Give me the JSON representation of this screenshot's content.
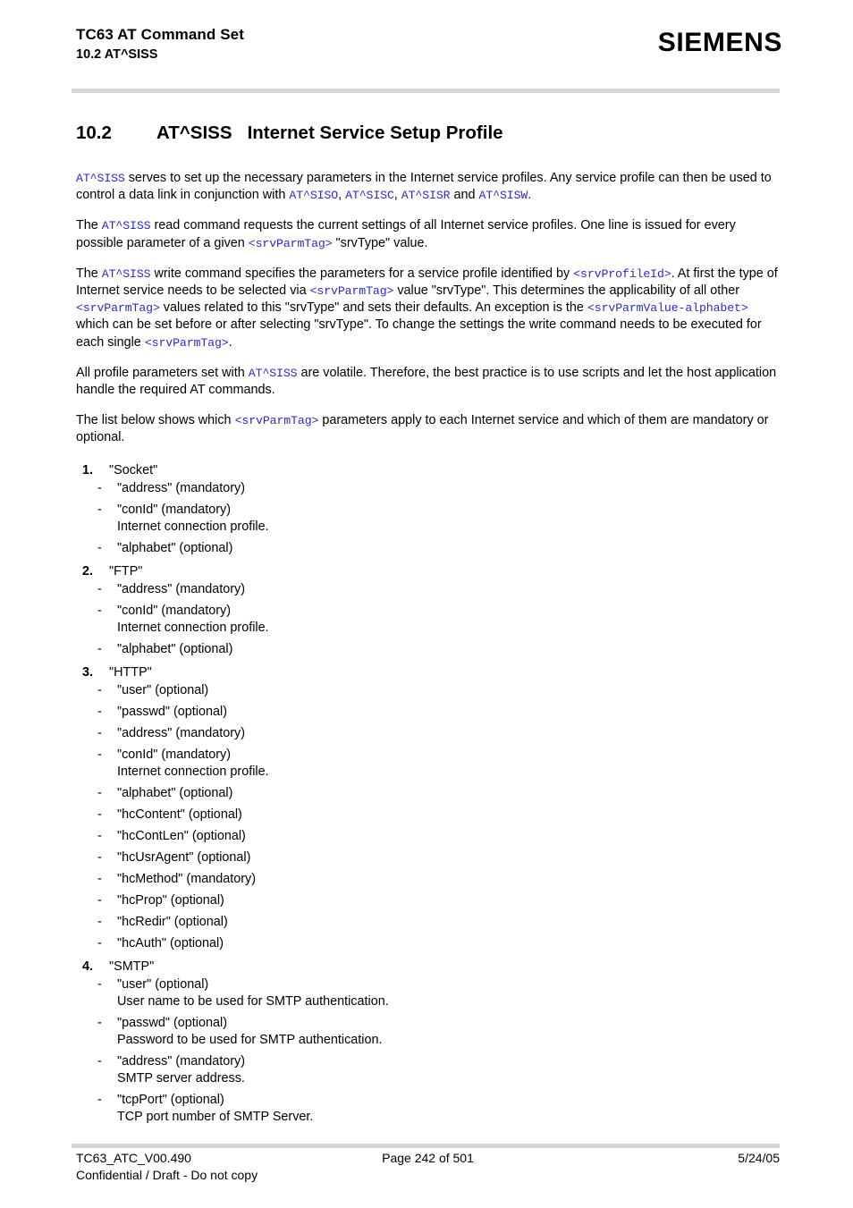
{
  "header": {
    "doc_title": "TC63 AT Command Set",
    "section_ref": "10.2 AT^SISS",
    "logo": "SIEMENS"
  },
  "heading": {
    "number": "10.2",
    "command": "AT^SISS",
    "title": "Internet Service Setup Profile"
  },
  "paragraphs": {
    "p1": {
      "c1": "AT^SISS",
      "t1": " serves to set up the necessary parameters in the Internet service profiles. Any service profile can then be used to control a data link in conjunction with ",
      "c2": "AT^SISO",
      "t2": ", ",
      "c3": "AT^SISC",
      "t3": ", ",
      "c4": "AT^SISR",
      "t4": " and ",
      "c5": "AT^SISW",
      "t5": "."
    },
    "p2": {
      "t1": "The ",
      "c1": "AT^SISS",
      "t2": " read command requests the current settings of all Internet service profiles. One line is issued for every possible parameter of a given ",
      "c2": "<srvParmTag>",
      "t3": " \"srvType\" value."
    },
    "p3": {
      "t1": "The ",
      "c1": "AT^SISS",
      "t2": " write command specifies the parameters for a service profile identified by ",
      "c2": "<srvProfileId>",
      "t3": ". At first the type of Internet service needs to be selected via ",
      "c3": "<srvParmTag>",
      "t4": " value \"srvType\". This determines the applicability of all other ",
      "c4": "<srvParmTag>",
      "t5": " values related to this \"srvType\" and sets their defaults. An exception is the ",
      "c5": "<srvParmValue-alphabet>",
      "t6": " which can be set before or after selecting \"srvType\". To change the settings the write command needs to be executed for each single ",
      "c6": "<srvParmTag>",
      "t7": "."
    },
    "p4": {
      "t1": "All profile parameters set with ",
      "c1": "AT^SISS",
      "t2": " are volatile. Therefore, the best practice is to use scripts and let the host application handle the required AT commands."
    },
    "p5": {
      "t1": "The list below shows which ",
      "c1": "<srvParmTag>",
      "t2": " parameters apply to each Internet service and which of them are mandatory or optional."
    }
  },
  "services": [
    {
      "index": "1.",
      "name": "\"Socket\"",
      "params": [
        {
          "label": "\"address\" (mandatory)",
          "desc": ""
        },
        {
          "label": "\"conId\" (mandatory)",
          "desc": "Internet connection profile."
        },
        {
          "label": "\"alphabet\" (optional)",
          "desc": ""
        }
      ]
    },
    {
      "index": "2.",
      "name": "\"FTP\"",
      "params": [
        {
          "label": "\"address\" (mandatory)",
          "desc": ""
        },
        {
          "label": "\"conId\" (mandatory)",
          "desc": "Internet connection profile."
        },
        {
          "label": "\"alphabet\" (optional)",
          "desc": ""
        }
      ]
    },
    {
      "index": "3.",
      "name": "\"HTTP\"",
      "params": [
        {
          "label": "\"user\" (optional)",
          "desc": ""
        },
        {
          "label": "\"passwd\" (optional)",
          "desc": ""
        },
        {
          "label": "\"address\" (mandatory)",
          "desc": ""
        },
        {
          "label": "\"conId\" (mandatory)",
          "desc": "Internet connection profile."
        },
        {
          "label": "\"alphabet\" (optional)",
          "desc": ""
        },
        {
          "label": "\"hcContent\" (optional)",
          "desc": ""
        },
        {
          "label": "\"hcContLen\" (optional)",
          "desc": ""
        },
        {
          "label": "\"hcUsrAgent\" (optional)",
          "desc": ""
        },
        {
          "label": "\"hcMethod\" (mandatory)",
          "desc": ""
        },
        {
          "label": "\"hcProp\" (optional)",
          "desc": ""
        },
        {
          "label": "\"hcRedir\" (optional)",
          "desc": ""
        },
        {
          "label": "\"hcAuth\" (optional)",
          "desc": ""
        }
      ]
    },
    {
      "index": "4.",
      "name": "\"SMTP\"",
      "params": [
        {
          "label": "\"user\" (optional)",
          "desc": "User name to be used for SMTP authentication."
        },
        {
          "label": "\"passwd\" (optional)",
          "desc": "Password to be used for SMTP authentication."
        },
        {
          "label": "\"address\" (mandatory)",
          "desc": "SMTP server address."
        },
        {
          "label": "\"tcpPort\" (optional)",
          "desc": "TCP port number of SMTP Server."
        }
      ]
    }
  ],
  "footer": {
    "doc_id": "TC63_ATC_V00.490",
    "page": "Page 242 of 501",
    "date": "5/24/05",
    "confidential": "Confidential / Draft - Do not copy"
  },
  "colors": {
    "code_blue": "#2a2ac8",
    "rule_gray": "#d5d5d5"
  }
}
